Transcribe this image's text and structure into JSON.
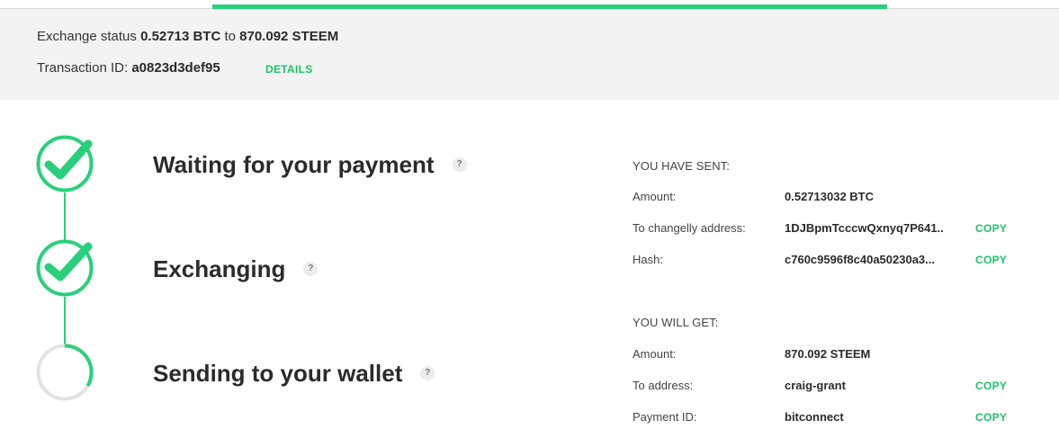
{
  "progress": {
    "percent": 100
  },
  "exchange": {
    "status_label": "Exchange status",
    "from_amount": "0.52713 BTC",
    "to_word": "to",
    "to_amount": "870.092 STEEM",
    "txid_label": "Transaction ID:",
    "txid": "a0823d3def95",
    "details_label": "DETAILS"
  },
  "steps": [
    {
      "label": "Waiting for your payment",
      "state": "done",
      "help": "?"
    },
    {
      "label": "Exchanging",
      "state": "done",
      "help": "?"
    },
    {
      "label": "Sending to your wallet",
      "state": "in-progress",
      "help": "?"
    }
  ],
  "sent": {
    "heading": "YOU HAVE SENT:",
    "amount_label": "Amount:",
    "amount": "0.52713032 BTC",
    "address_label": "To changelly address:",
    "address": "1DJBpmTcccwQxnyq7P641..",
    "hash_label": "Hash:",
    "hash": "c760c9596f8c40a50230a3...",
    "copy_label": "COPY"
  },
  "get": {
    "heading": "YOU WILL GET:",
    "amount_label": "Amount:",
    "amount": "870.092 STEEM",
    "address_label": "To address:",
    "address": "craig-grant",
    "payment_id_label": "Payment ID:",
    "payment_id": "bitconnect",
    "copy_label": "COPY"
  },
  "colors": {
    "accent": "#27d07a",
    "link": "#1ec36b",
    "status_bg": "#f3f3f3"
  },
  "icons": [
    "check-circle-icon",
    "check-circle-icon",
    "loading-ring-icon"
  ]
}
